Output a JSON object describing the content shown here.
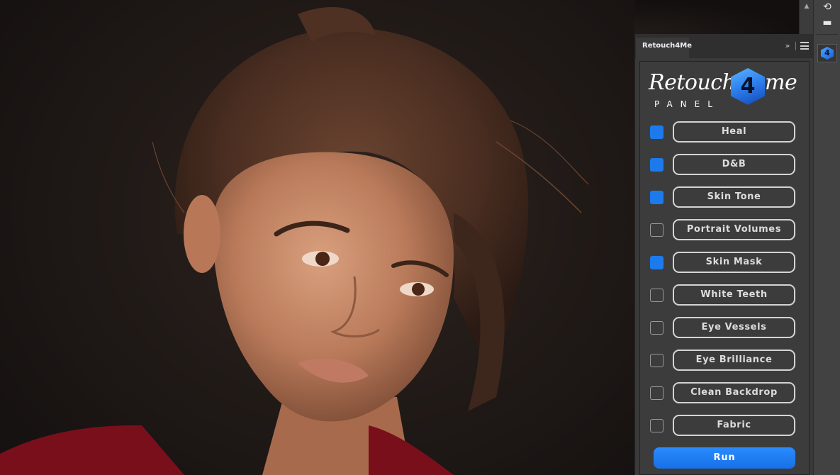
{
  "panel": {
    "tab_label": "Retouch4Me",
    "collapse_glyph": "»",
    "logo": {
      "word": "Retouch",
      "badge_glyph": "4",
      "word_end": "me",
      "subtitle": "PANEL"
    },
    "modules": [
      {
        "label": "Heal",
        "checked": true
      },
      {
        "label": "D&B",
        "checked": true
      },
      {
        "label": "Skin Tone",
        "checked": true
      },
      {
        "label": "Portrait Volumes",
        "checked": false
      },
      {
        "label": "Skin Mask",
        "checked": true
      },
      {
        "label": "White Teeth",
        "checked": false
      },
      {
        "label": "Eye Vessels",
        "checked": false
      },
      {
        "label": "Eye Brilliance",
        "checked": false
      },
      {
        "label": "Clean Backdrop",
        "checked": false
      },
      {
        "label": "Fabric",
        "checked": false
      }
    ],
    "run_label": "Run"
  },
  "side_strip": {
    "scroll_up_glyph": "▲",
    "tool1_glyph": "⟲",
    "tool2_glyph": "▬",
    "panel_icon_glyph": "4"
  },
  "colors": {
    "accent": "#1c7aec",
    "panel_bg": "#3c3c3c",
    "button_border": "#d4d4d4"
  }
}
